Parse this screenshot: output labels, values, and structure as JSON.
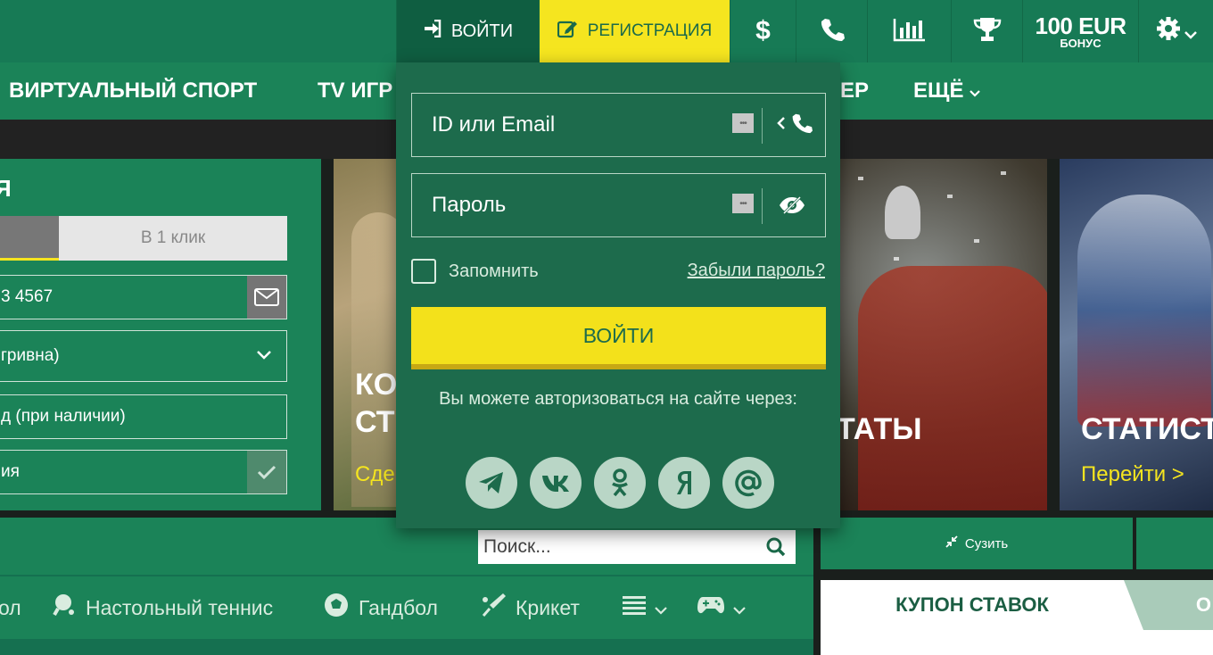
{
  "topbar": {
    "login_label": "ВОЙТИ",
    "register_label": "РЕГИСТРАЦИЯ",
    "currency_symbol": "$",
    "bonus_amount": "100 EUR",
    "bonus_label": "БОНУС"
  },
  "nav": {
    "items": [
      "ВИРТУАЛЬНЫЙ СПОРТ",
      "TV ИГР",
      "ЕР",
      "ЕЩЁ"
    ]
  },
  "registration": {
    "title_fragment": "Я",
    "one_click_tab": "В 1 клик",
    "phone_value": "3 4567",
    "currency_value": "гривна)",
    "promo_placeholder": "д (при наличии)",
    "terms_text": "ия"
  },
  "banners": [
    {
      "title_lines": [
        "КО",
        "СТ"
      ],
      "link": "Сде"
    },
    {
      "title": "ТАТЫ"
    },
    {
      "title": "СТАТИСТ",
      "link": "Перейти >"
    }
  ],
  "login_panel": {
    "id_placeholder": "ID или Email",
    "password_placeholder": "Пароль",
    "remember_label": "Запомнить",
    "forgot_link": "Забыли пароль?",
    "submit_label": "ВОЙТИ",
    "via_text": "Вы можете авторизоваться на сайте через:",
    "socials": [
      "telegram-icon",
      "vk-icon",
      "ok-icon",
      "yandex-icon",
      "mail-icon"
    ]
  },
  "search": {
    "placeholder": "Поиск..."
  },
  "sports": [
    "ол",
    "Настольный теннис",
    "Гандбол",
    "Крикет"
  ],
  "right_panel": {
    "collapse_label": "Сузить",
    "coupon_label": "КУПОН СТАВОК",
    "coupon_tab2": "О"
  },
  "colors": {
    "brand_green": "#1b8358",
    "dark_green": "#1d6b4c",
    "accent_yellow": "#f3e11b"
  }
}
